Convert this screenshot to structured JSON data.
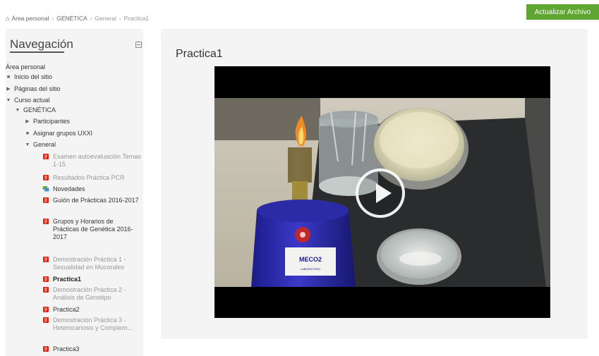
{
  "breadcrumb": {
    "items": [
      "Área personal",
      "GENÉTICA",
      "General",
      "Practica1"
    ]
  },
  "update_button": "Actualizar Archivo",
  "nav": {
    "title": "Navegación",
    "root": "Área personal",
    "inicio": "Inicio del sitio",
    "paginas": "Páginas del sitio",
    "curso": "Curso actual",
    "genetica": "GENÉTICA",
    "participantes": "Participantes",
    "asignar": "Asignar grupos UXXI",
    "general": "General",
    "items": [
      {
        "label": "Examen autoevaluación Temas 1-15",
        "icon": "pdf-icon"
      },
      {
        "label": "Resultados Práctica PCR",
        "icon": "pdf-icon"
      },
      {
        "label": "Novedades",
        "icon": "forum-icon"
      },
      {
        "label": "Guión de Prácticas 2016-2017",
        "icon": "pdf-icon"
      },
      {
        "label": "Grupos y Horarios de Prácticas de Genética 2016-2017",
        "icon": "pdf-icon"
      },
      {
        "label": "Demostración Práctica 1 - Sexualidad en Mucorales",
        "icon": "pdf-icon"
      },
      {
        "label": "Practica1",
        "icon": "pdf-icon"
      },
      {
        "label": "Demostración Práctica 2 - Análisis de Genotipo",
        "icon": "pdf-icon"
      },
      {
        "label": "Practica2",
        "icon": "pdf-icon"
      },
      {
        "label": "Demostración Práctica 3 - Heterocariosis y Complem...",
        "icon": "pdf-icon"
      },
      {
        "label": "Practica3",
        "icon": "pdf-icon"
      }
    ]
  },
  "main": {
    "title": "Practica1",
    "bottle_label": "MECO2",
    "bottle_sublabel": "LABORATORIO"
  },
  "colors": {
    "accent_green": "#5fa531",
    "pdf_red": "#d9230f",
    "panel_bg": "#f4f4f4"
  }
}
